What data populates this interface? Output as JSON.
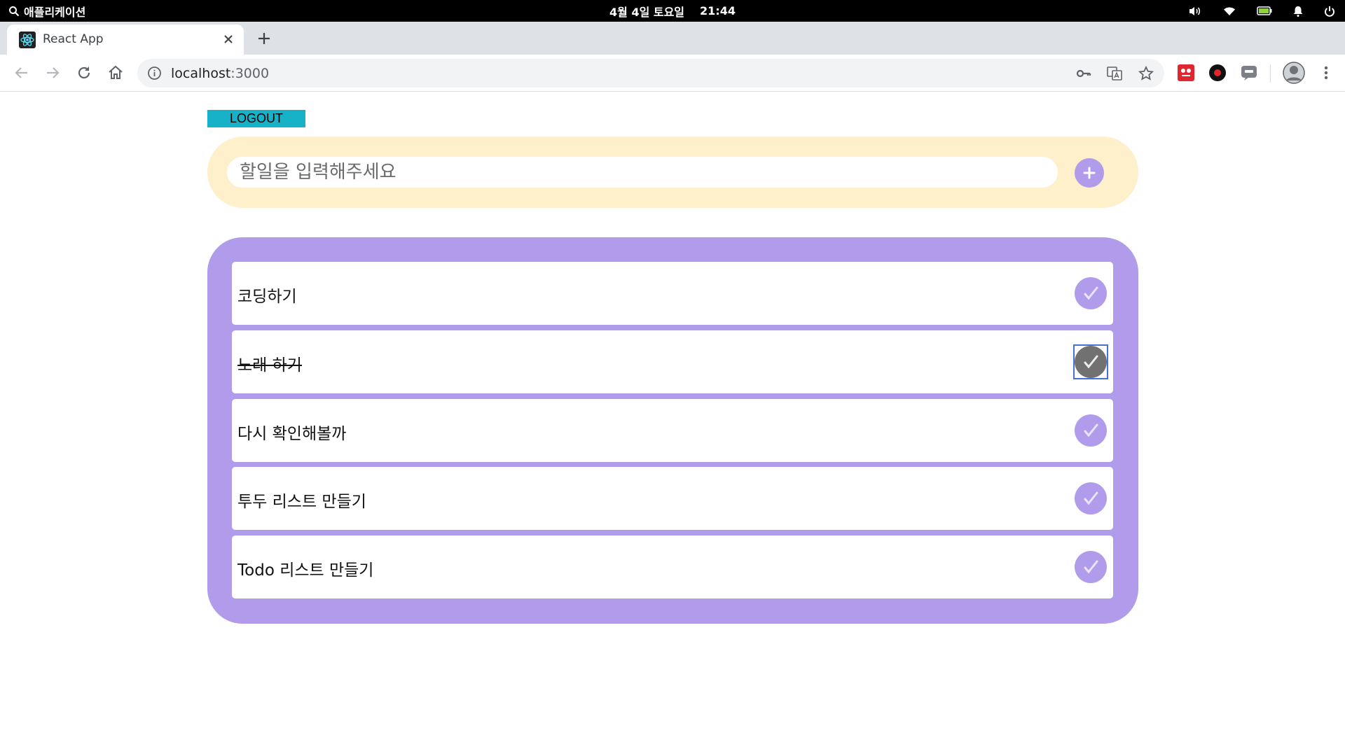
{
  "system_bar": {
    "activities_label": "애플리케이션",
    "date": "4월 4일 토요일",
    "time": "21:44"
  },
  "browser": {
    "tab": {
      "title": "React App"
    },
    "address_bar": {
      "host": "localhost",
      "port": ":3000"
    }
  },
  "app": {
    "logout_label": "LOGOUT",
    "input": {
      "placeholder": "할일을 입력해주세요",
      "value": ""
    },
    "add_button_label": "+",
    "todos": [
      {
        "text": "코딩하기",
        "done": false
      },
      {
        "text": "노래 하기",
        "done": true
      },
      {
        "text": "다시 확인해볼까",
        "done": false
      },
      {
        "text": "투두 리스트 만들기",
        "done": false
      },
      {
        "text": "Todo 리스트 만들기",
        "done": false
      }
    ]
  },
  "colors": {
    "accent_purple": "#b19cec",
    "form_background": "#fff0cc",
    "logout_button": "#17b2c8",
    "done_check": "#717171"
  },
  "icons": {
    "topbar": [
      "search-icon",
      "volume-icon",
      "wifi-icon",
      "battery-icon",
      "bell-icon",
      "power-icon"
    ],
    "toolbar": [
      "back-icon",
      "forward-icon",
      "reload-icon",
      "home-icon",
      "info-icon",
      "key-icon",
      "translate-icon",
      "star-icon",
      "kebab-menu-icon"
    ]
  }
}
